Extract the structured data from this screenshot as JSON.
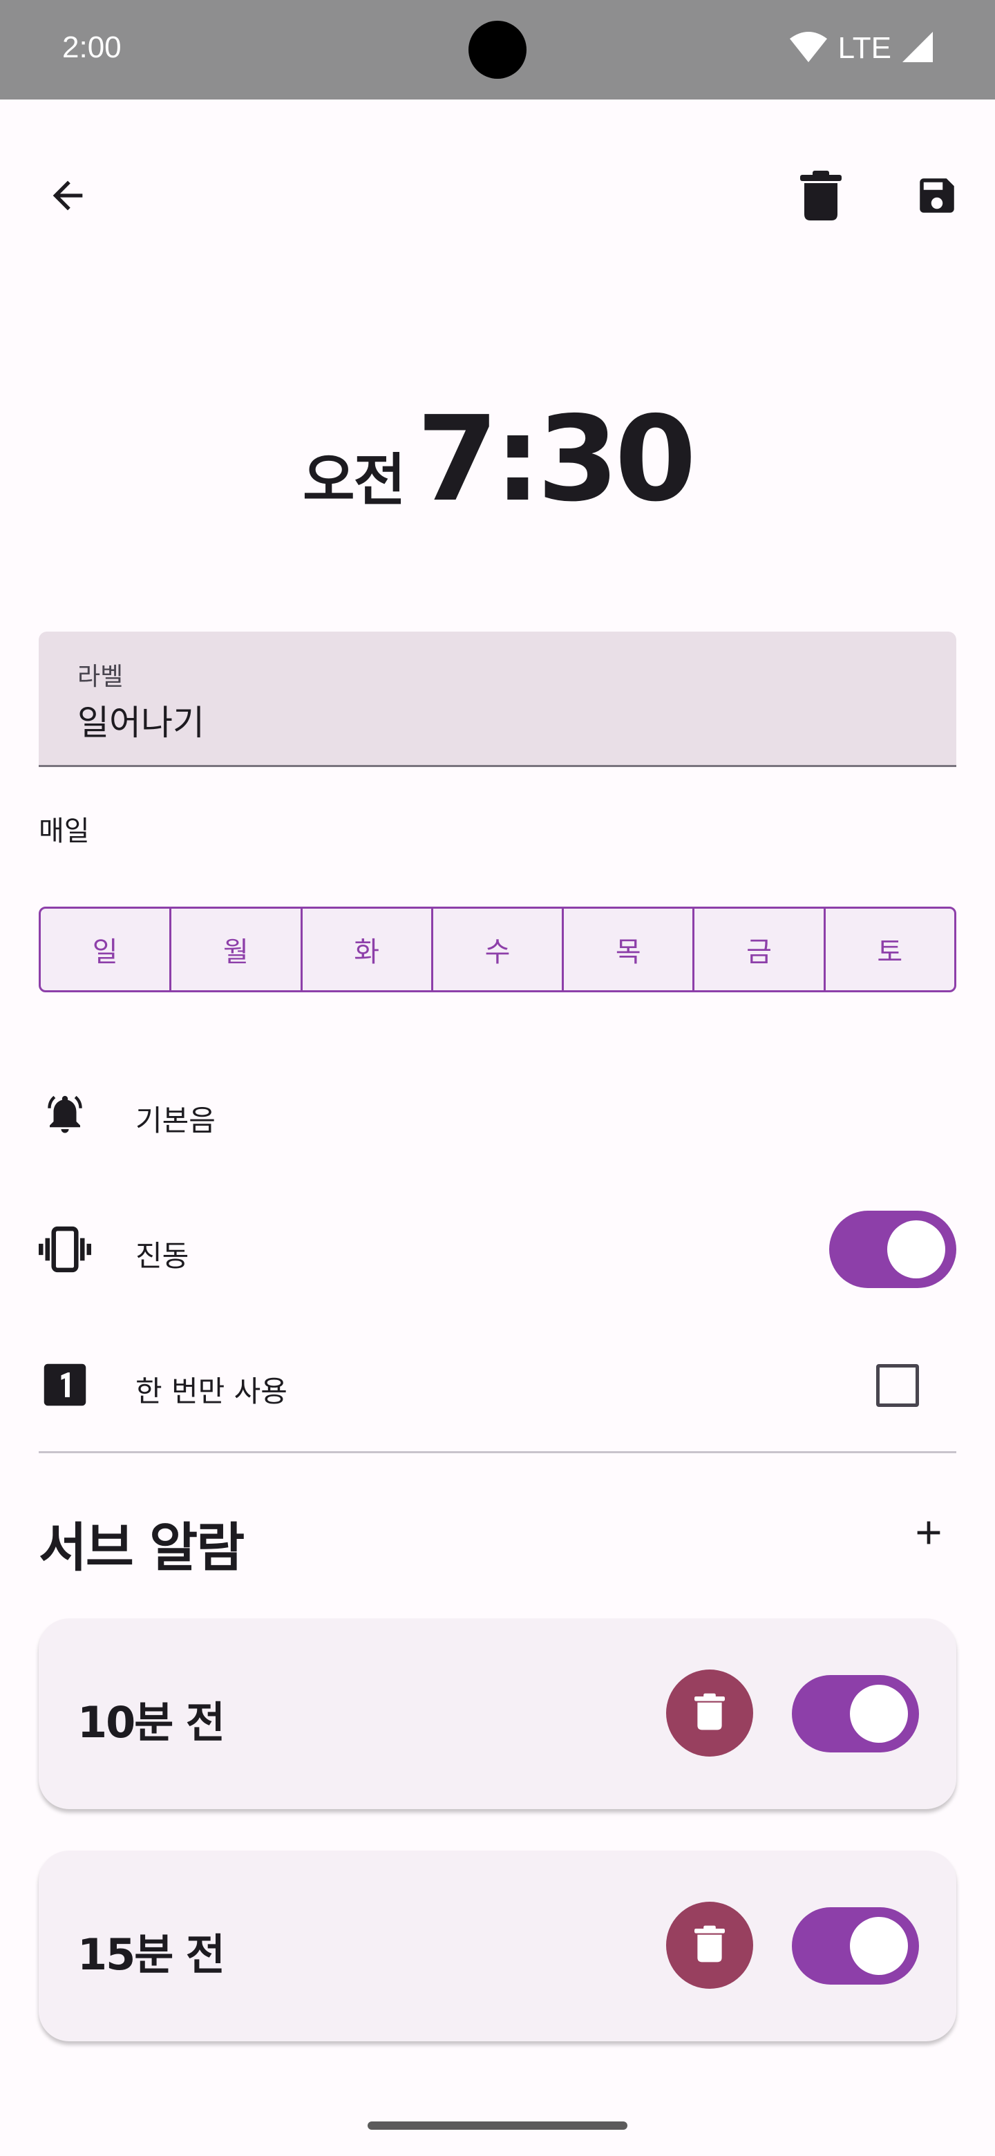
{
  "status_bar": {
    "time": "2:00",
    "network": "LTE",
    "icons": [
      "wifi-icon",
      "signal-icon"
    ]
  },
  "app_bar": {
    "back_icon": "arrow-left-icon",
    "delete_icon": "trash-icon",
    "save_icon": "floppy-disk-icon"
  },
  "alarm": {
    "ampm": "오전",
    "time": "7:30"
  },
  "label_field": {
    "caption": "라벨",
    "value": "일어나기"
  },
  "repeat": {
    "summary": "매일",
    "days": [
      "일",
      "월",
      "화",
      "수",
      "목",
      "금",
      "토"
    ],
    "selected_all": true
  },
  "settings": {
    "ringtone": {
      "label": "기본음",
      "icon": "bell-icon"
    },
    "vibrate": {
      "label": "진동",
      "icon": "vibrate-icon",
      "enabled": true
    },
    "once": {
      "label": "한 번만 사용",
      "icon": "looks-one-icon",
      "checked": false
    }
  },
  "sub_alarms": {
    "title": "서브 알람",
    "add_icon": "plus-icon",
    "items": [
      {
        "label": "10분 전",
        "enabled": true
      },
      {
        "label": "15분 전",
        "enabled": true
      }
    ]
  },
  "colors": {
    "primary": "#8d3fa9",
    "delete_button": "#98405f",
    "background": "#fffbfe",
    "label_field_bg": "#e9dfe7",
    "card_bg": "#f6f0f6",
    "status_bar_bg": "#8e8e8f"
  }
}
